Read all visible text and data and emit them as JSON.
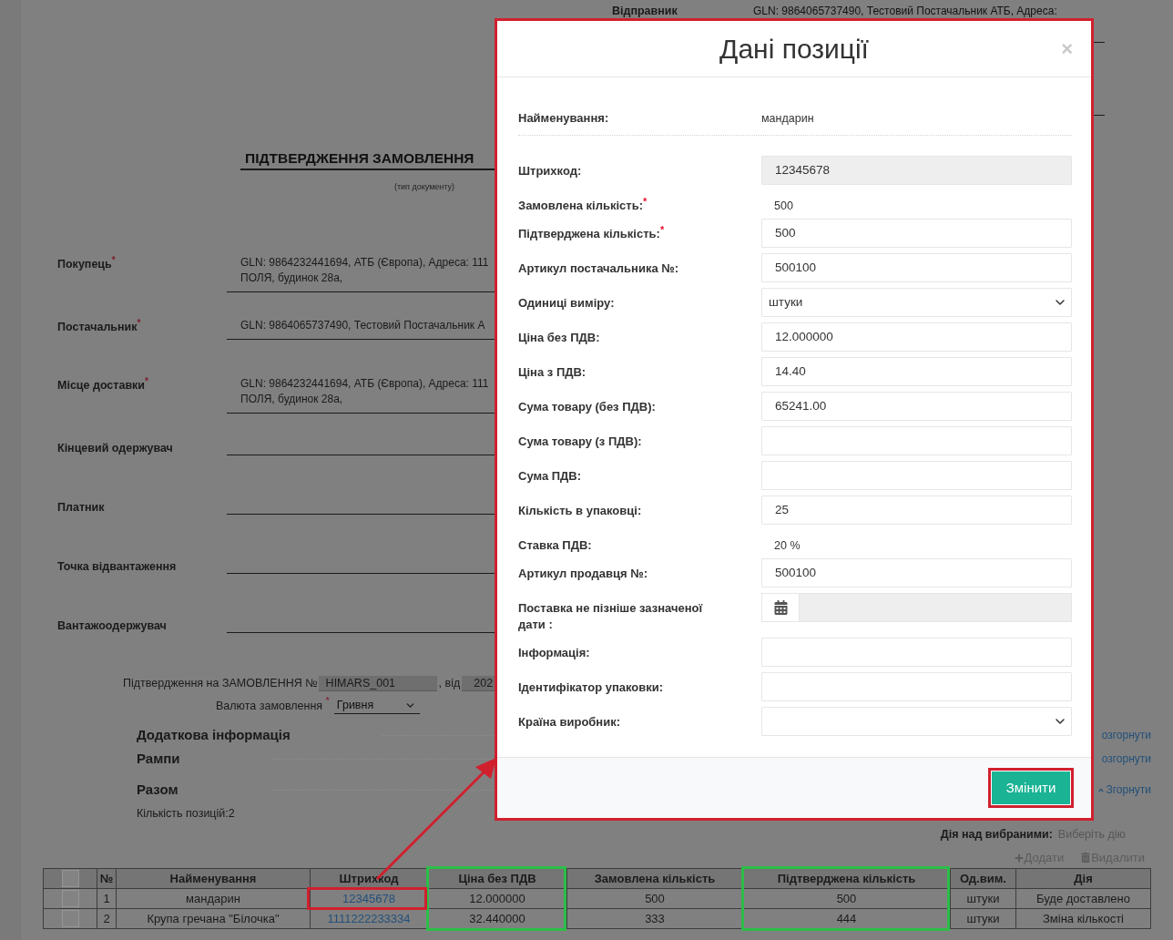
{
  "sender": {
    "label": "Відправник",
    "value": "GLN: 9864065737490, Тестовий Постачальник АТБ, Адреса:"
  },
  "document": {
    "title": "ПІДТВЕРДЖЕННЯ ЗАМОВЛЕННЯ",
    "caption": "(тип документу)"
  },
  "parties": [
    {
      "label": "Покупець$^{*}$",
      "value_lines": [
        "GLN: 9864232441694, АТБ (Європа), Адреса: 111",
        "ПОЛЯ, будинок 28а,"
      ]
    },
    {
      "label": "Постачальник$^{*}$",
      "value_lines": [
        "GLN: 9864065737490, Тестовий Постачальник А"
      ]
    },
    {
      "label": "Місце доставки$^{*}$",
      "value_lines": [
        "GLN: 9864232441694, АТБ (Європа), Адреса: 111",
        "ПОЛЯ, будинок 28а,"
      ]
    },
    {
      "label": "Кінцевий одержувач"
    },
    {
      "label": "Платник"
    },
    {
      "label": "Точка відвантаження"
    },
    {
      "label": "Вантажоодержувач"
    }
  ],
  "order_reference": {
    "label": "Підтвердження на ЗАМОВЛЕННЯ №",
    "number": "HIMARS_001",
    "date_label": ", від",
    "date": "202"
  },
  "currency": {
    "label": "Валюта замовлення $^{*}$",
    "value": "Гривня"
  },
  "sections": [
    {
      "title": "Додаткова інформація",
      "toggle": "озгорнути",
      "expanded": false
    },
    {
      "title": "Рампи",
      "toggle": "озгорнути",
      "expanded": false
    },
    {
      "title": "Разом",
      "toggle": "Згорнути",
      "expanded": true,
      "content": "Кількість позицій:2"
    }
  ],
  "bulk_actions": {
    "label": "Дія над вибраними:",
    "placeholder": "Виберіть дію"
  },
  "toolbar": [
    {
      "kind": "add",
      "label": "Додати",
      "disabled": true
    },
    {
      "kind": "delete",
      "label": "Видалити",
      "disabled": true
    }
  ],
  "table": {
    "select_all": {
      "checked": false
    },
    "columns": [
      {
        "label": "№",
        "kind": "text",
        "outlined": false
      },
      {
        "label": "Найменування",
        "kind": "text",
        "outlined": false
      },
      {
        "label": "Штрихкод",
        "kind": "link",
        "outlined": false
      },
      {
        "label": "Ціна без ПДВ",
        "kind": "text",
        "outlined": true
      },
      {
        "label": "Замовлена кількість",
        "kind": "text",
        "outlined": false
      },
      {
        "label": "Підтверджена кількість",
        "kind": "text",
        "outlined": true
      },
      {
        "label": "Од.вим.",
        "kind": "text",
        "outlined": false
      },
      {
        "label": "Дія",
        "kind": "text",
        "outlined": false
      }
    ],
    "rows": [
      {
        "checked": false,
        "link_outlined": true,
        "cells": [
          "1",
          "мандарин",
          "12345678",
          "12.000000",
          "500",
          "500",
          "штуки",
          "Буде доставлено"
        ]
      },
      {
        "checked": false,
        "link_outlined": false,
        "cells": [
          "2",
          "Крупа гречана \"Білочка\"",
          "1111222233334",
          "32.440000",
          "333",
          "444",
          "штуки",
          "Зміна кількості"
        ]
      }
    ]
  },
  "dialog": {
    "title": "Дані позиції",
    "close": "×",
    "outlined": true,
    "arrow_from_table": true,
    "fields": [
      {
        "kind": "summary",
        "label": "Найменування:",
        "value": "мандарин"
      },
      {
        "kind": "readonly",
        "label": "Штрихкод:",
        "value": "12345678"
      },
      {
        "kind": "text",
        "label": "Замовлена кількість:$^{*}$",
        "value": "500"
      },
      {
        "kind": "input",
        "label": "Підтверджена кількість:$^{*}$",
        "value": "500"
      },
      {
        "kind": "input",
        "label": "Артикул постачальника №:",
        "value": "500100"
      },
      {
        "kind": "select",
        "label": "Одиниці виміру:",
        "value": "штуки"
      },
      {
        "kind": "input",
        "label": "Ціна без ПДВ:",
        "value": "12.000000"
      },
      {
        "kind": "input",
        "label": "Ціна з ПДВ:",
        "value": "14.40"
      },
      {
        "kind": "input",
        "label": "Сума товару (без ПДВ):",
        "value": "65241.00"
      },
      {
        "kind": "input",
        "label": "Сума товару (з ПДВ):"
      },
      {
        "kind": "input",
        "label": "Сума ПДВ:"
      },
      {
        "kind": "input",
        "label": "Кількість в упаковці:",
        "value": "25"
      },
      {
        "kind": "text",
        "label": "Ставка ПДВ:",
        "value": "20 %"
      },
      {
        "kind": "input",
        "label": "Артикул продавця №:",
        "value": "500100"
      },
      {
        "kind": "date",
        "label": "Поставка не пізніше зазначеної дати :"
      },
      {
        "kind": "input",
        "label": "Інформація:"
      },
      {
        "kind": "input",
        "label": "Ідентифікатор упаковки:"
      },
      {
        "kind": "select",
        "label": "Країна виробник:"
      }
    ],
    "submit": {
      "label": "Змінити",
      "outlined": true
    }
  }
}
